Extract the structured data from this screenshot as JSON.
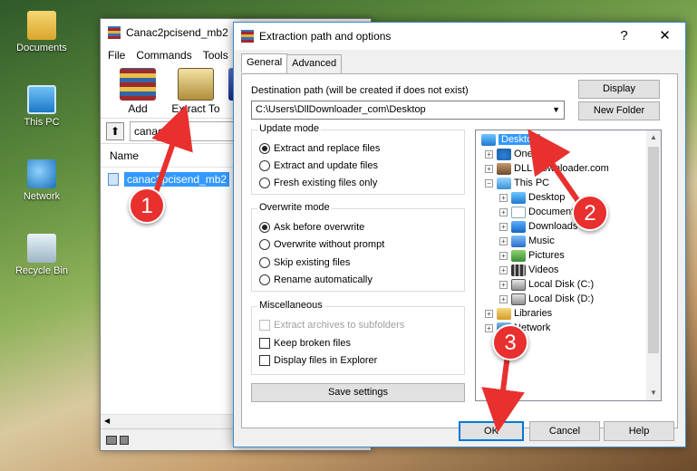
{
  "desktop": {
    "icons": [
      {
        "label": "Documents",
        "icon": "folder-documents-icon"
      },
      {
        "label": "This PC",
        "icon": "computer-icon"
      },
      {
        "label": "Network",
        "icon": "network-globe-icon"
      },
      {
        "label": "Recycle Bin",
        "icon": "recycle-bin-icon"
      }
    ]
  },
  "winrar": {
    "title": "Canac2pcisend_mb2",
    "menu": [
      "File",
      "Commands",
      "Tools"
    ],
    "toolbar": {
      "add": "Add",
      "extract_to": "Extract To",
      "third": "T"
    },
    "path": "canac2pci",
    "column_name": "Name",
    "file": "canac2pcisend_mb2"
  },
  "dialog": {
    "title": "Extraction path and options",
    "help": "?",
    "close": "✕",
    "tabs": [
      "General",
      "Advanced"
    ],
    "destination_label": "Destination path (will be created if does not exist)",
    "destination_value": "C:\\Users\\DllDownloader_com\\Desktop",
    "display_btn": "Display",
    "new_folder_btn": "New Folder",
    "update_mode": {
      "title": "Update mode",
      "options": [
        "Extract and replace files",
        "Extract and update files",
        "Fresh existing files only"
      ],
      "selected": 0
    },
    "overwrite_mode": {
      "title": "Overwrite mode",
      "options": [
        "Ask before overwrite",
        "Overwrite without prompt",
        "Skip existing files",
        "Rename automatically"
      ],
      "selected": 0
    },
    "misc": {
      "title": "Miscellaneous",
      "options": [
        "Extract archives to subfolders",
        "Keep broken files",
        "Display files in Explorer"
      ]
    },
    "save_settings": "Save settings",
    "tree": [
      {
        "label": "Desktop",
        "selected": true
      },
      {
        "label": "OneD"
      },
      {
        "label": "DLL Downloader.com"
      },
      {
        "label": "This PC"
      },
      {
        "label": "Desktop"
      },
      {
        "label": "Document"
      },
      {
        "label": "Downloads"
      },
      {
        "label": "Music"
      },
      {
        "label": "Pictures"
      },
      {
        "label": "Videos"
      },
      {
        "label": "Local Disk (C:)"
      },
      {
        "label": "Local Disk (D:)"
      },
      {
        "label": "Libraries"
      },
      {
        "label": "Network"
      }
    ],
    "ok": "OK",
    "cancel": "Cancel",
    "help_btn": "Help"
  },
  "annotations": {
    "step1": "1",
    "step2": "2",
    "step3": "3",
    "color": "#e8302f"
  }
}
